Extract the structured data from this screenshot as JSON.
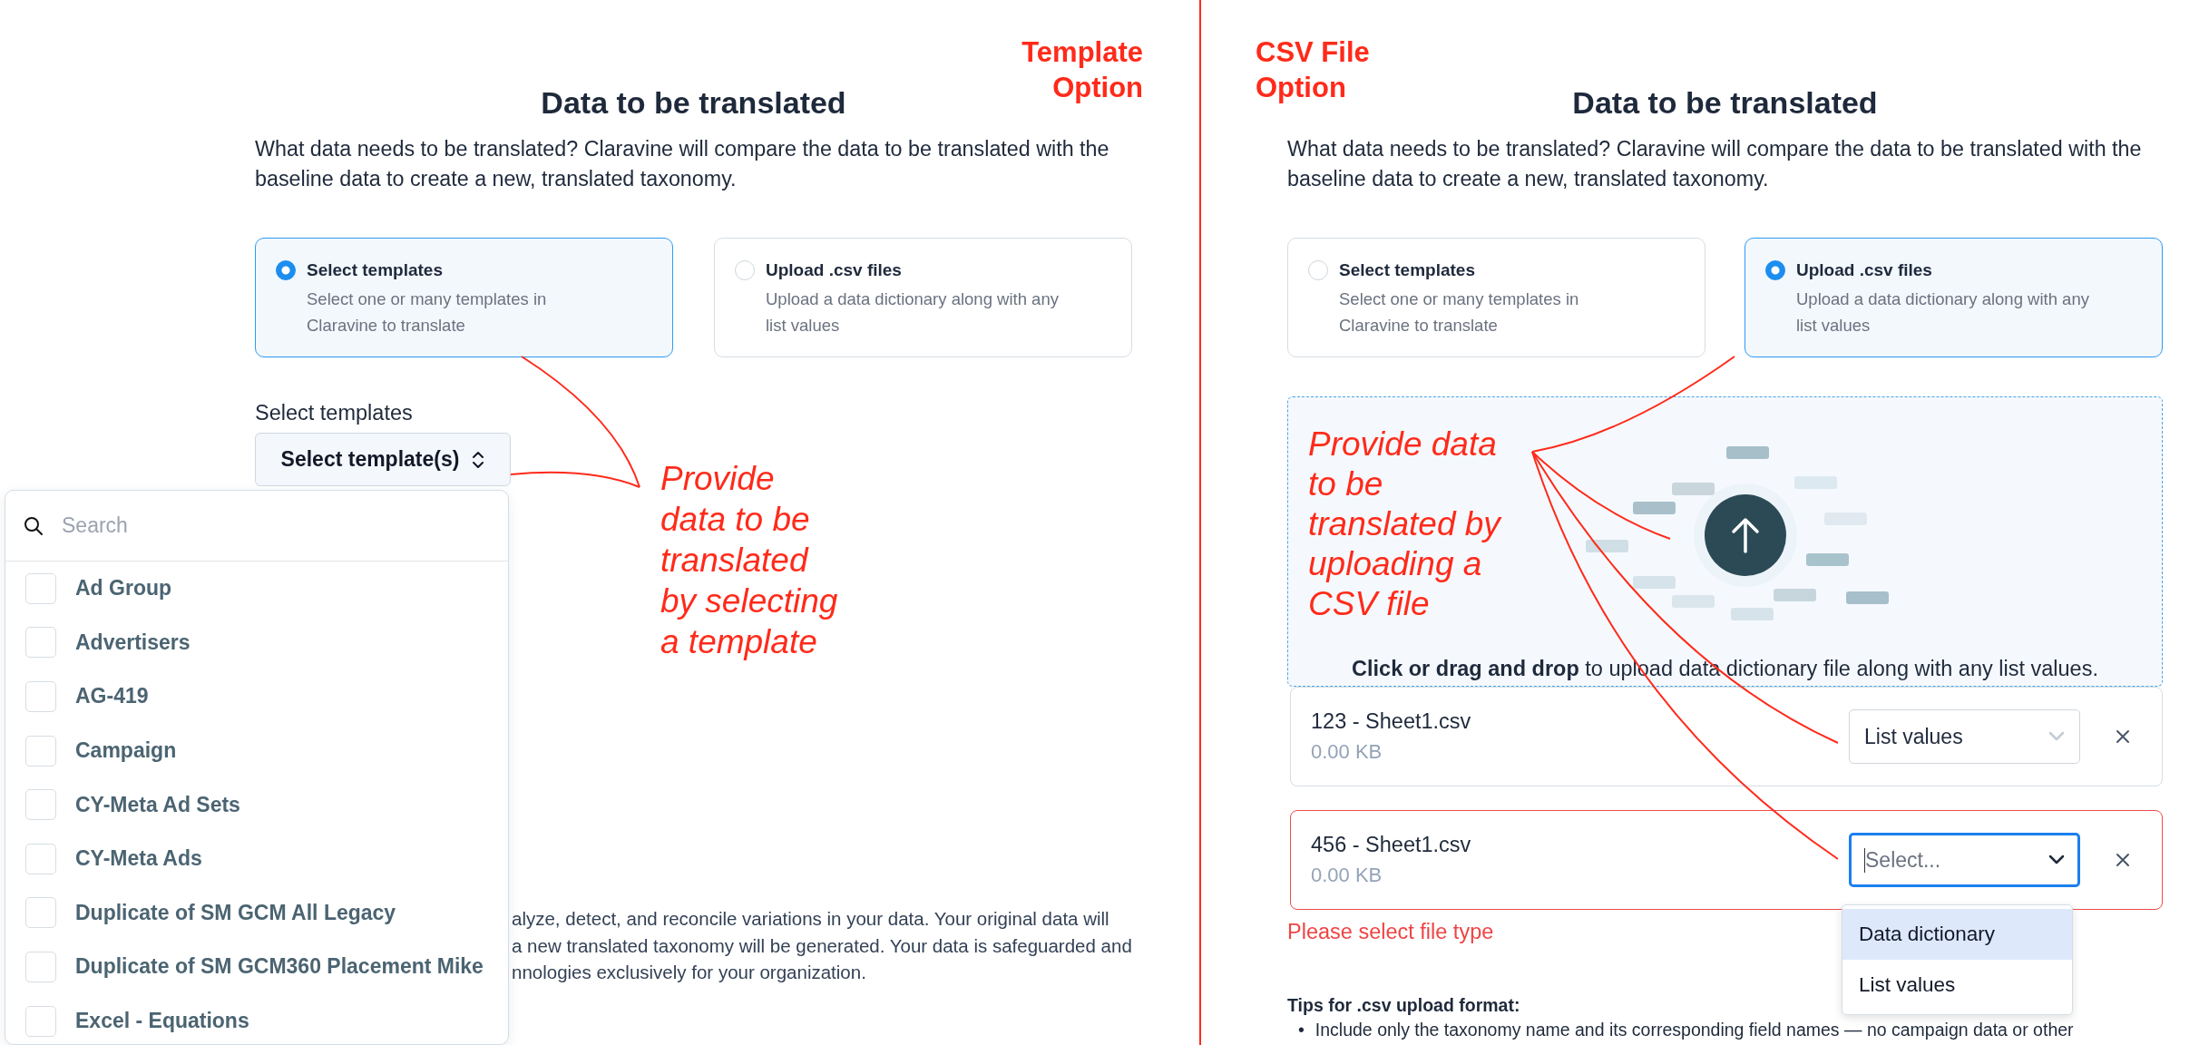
{
  "panels": [
    {
      "kind": "templates",
      "option_label": "Template\nOption",
      "heading": "Data to be translated",
      "description": "What data needs to be translated? Claravine will compare the data to be translated with the\nbaseline data to create a new, translated taxonomy.",
      "options": [
        {
          "title": "Select templates",
          "description": "Select one or many templates in\nClaravine to translate",
          "selected": true
        },
        {
          "title": "Upload .csv files",
          "description": "Upload a data dictionary along with any\nlist values",
          "selected": false
        }
      ],
      "select_label": "Select templates",
      "select_button": "Select template(s)",
      "dropdown": {
        "search_placeholder": "Search",
        "items": [
          {
            "label": "Ad Group",
            "checked": false
          },
          {
            "label": "Advertisers",
            "checked": false
          },
          {
            "label": "AG-419",
            "checked": false
          },
          {
            "label": "Campaign",
            "checked": false
          },
          {
            "label": "CY-Meta Ad Sets",
            "checked": false
          },
          {
            "label": "CY-Meta Ads",
            "checked": false
          },
          {
            "label": "Duplicate of SM GCM All Legacy",
            "checked": false
          },
          {
            "label": "Duplicate of SM GCM360 Placement Mike",
            "checked": false
          },
          {
            "label": "Excel - Equations",
            "checked": false
          }
        ]
      },
      "note_lines": [
        "alyze, detect, and reconcile variations in your data. Your original data will",
        "a new translated taxonomy will be generated. Your data is safeguarded and",
        "nnologies exclusively for your organization."
      ],
      "callout": "Provide\ndata to be\ntranslated\nby selecting\na template"
    },
    {
      "kind": "csv",
      "option_label": "CSV File\nOption",
      "heading": "Data to be translated",
      "description": "What data needs to be translated? Claravine will compare the data to be translated with the\nbaseline data to create a new, translated taxonomy.",
      "options": [
        {
          "title": "Select templates",
          "description": "Select one or many templates in\nClaravine to translate",
          "selected": false
        },
        {
          "title": "Upload .csv files",
          "description": "Upload a data dictionary along with any\nlist values",
          "selected": true
        }
      ],
      "dropzone_prompt": "**Click or drag and drop** to upload data dictionary file along with any list values.",
      "files": [
        {
          "name": "123 - Sheet1.csv",
          "size": "0.00 KB",
          "value": "List values",
          "error": false,
          "focused": false
        },
        {
          "name": "456 - Sheet1.csv",
          "size": "0.00 KB",
          "placeholder": "Select...",
          "error": true,
          "focused": true
        }
      ],
      "error_message": "Please select file type",
      "type_menu": [
        {
          "label": "Data dictionary",
          "selected": true
        },
        {
          "label": "List values",
          "selected": false
        }
      ],
      "tips_title": "Tips for .csv upload format:",
      "tips": [
        {
          "marker": "•",
          "text": "Include only the taxonomy name and its corresponding field names — no campaign data or other"
        }
      ],
      "callout": "Provide data\nto be\ntranslated by\nuploading a\nCSV file"
    }
  ]
}
